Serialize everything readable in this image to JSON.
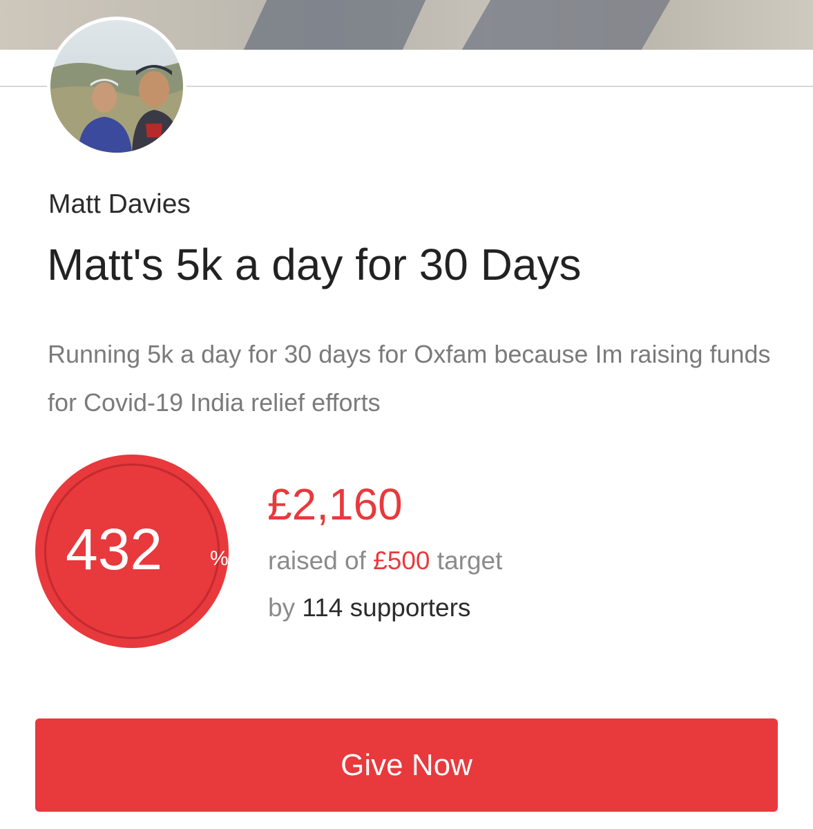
{
  "owner_name": "Matt Davies",
  "page_title": "Matt's 5k a day for 30 Days",
  "description": "Running 5k a day for 30 days for Oxfam because Im raising funds for Covid-19 India relief efforts",
  "progress": {
    "percent_value": "432",
    "percent_symbol": "%",
    "amount_raised": "£2,160",
    "raised_prefix": "raised of",
    "target_amount": "£500",
    "target_suffix": "target",
    "supporters_prefix": "by",
    "supporters_count": "114 supporters"
  },
  "give_button_label": "Give Now",
  "colors": {
    "accent": "#e8393d",
    "text_dark": "#222222",
    "text_muted": "#7a7a7a"
  }
}
